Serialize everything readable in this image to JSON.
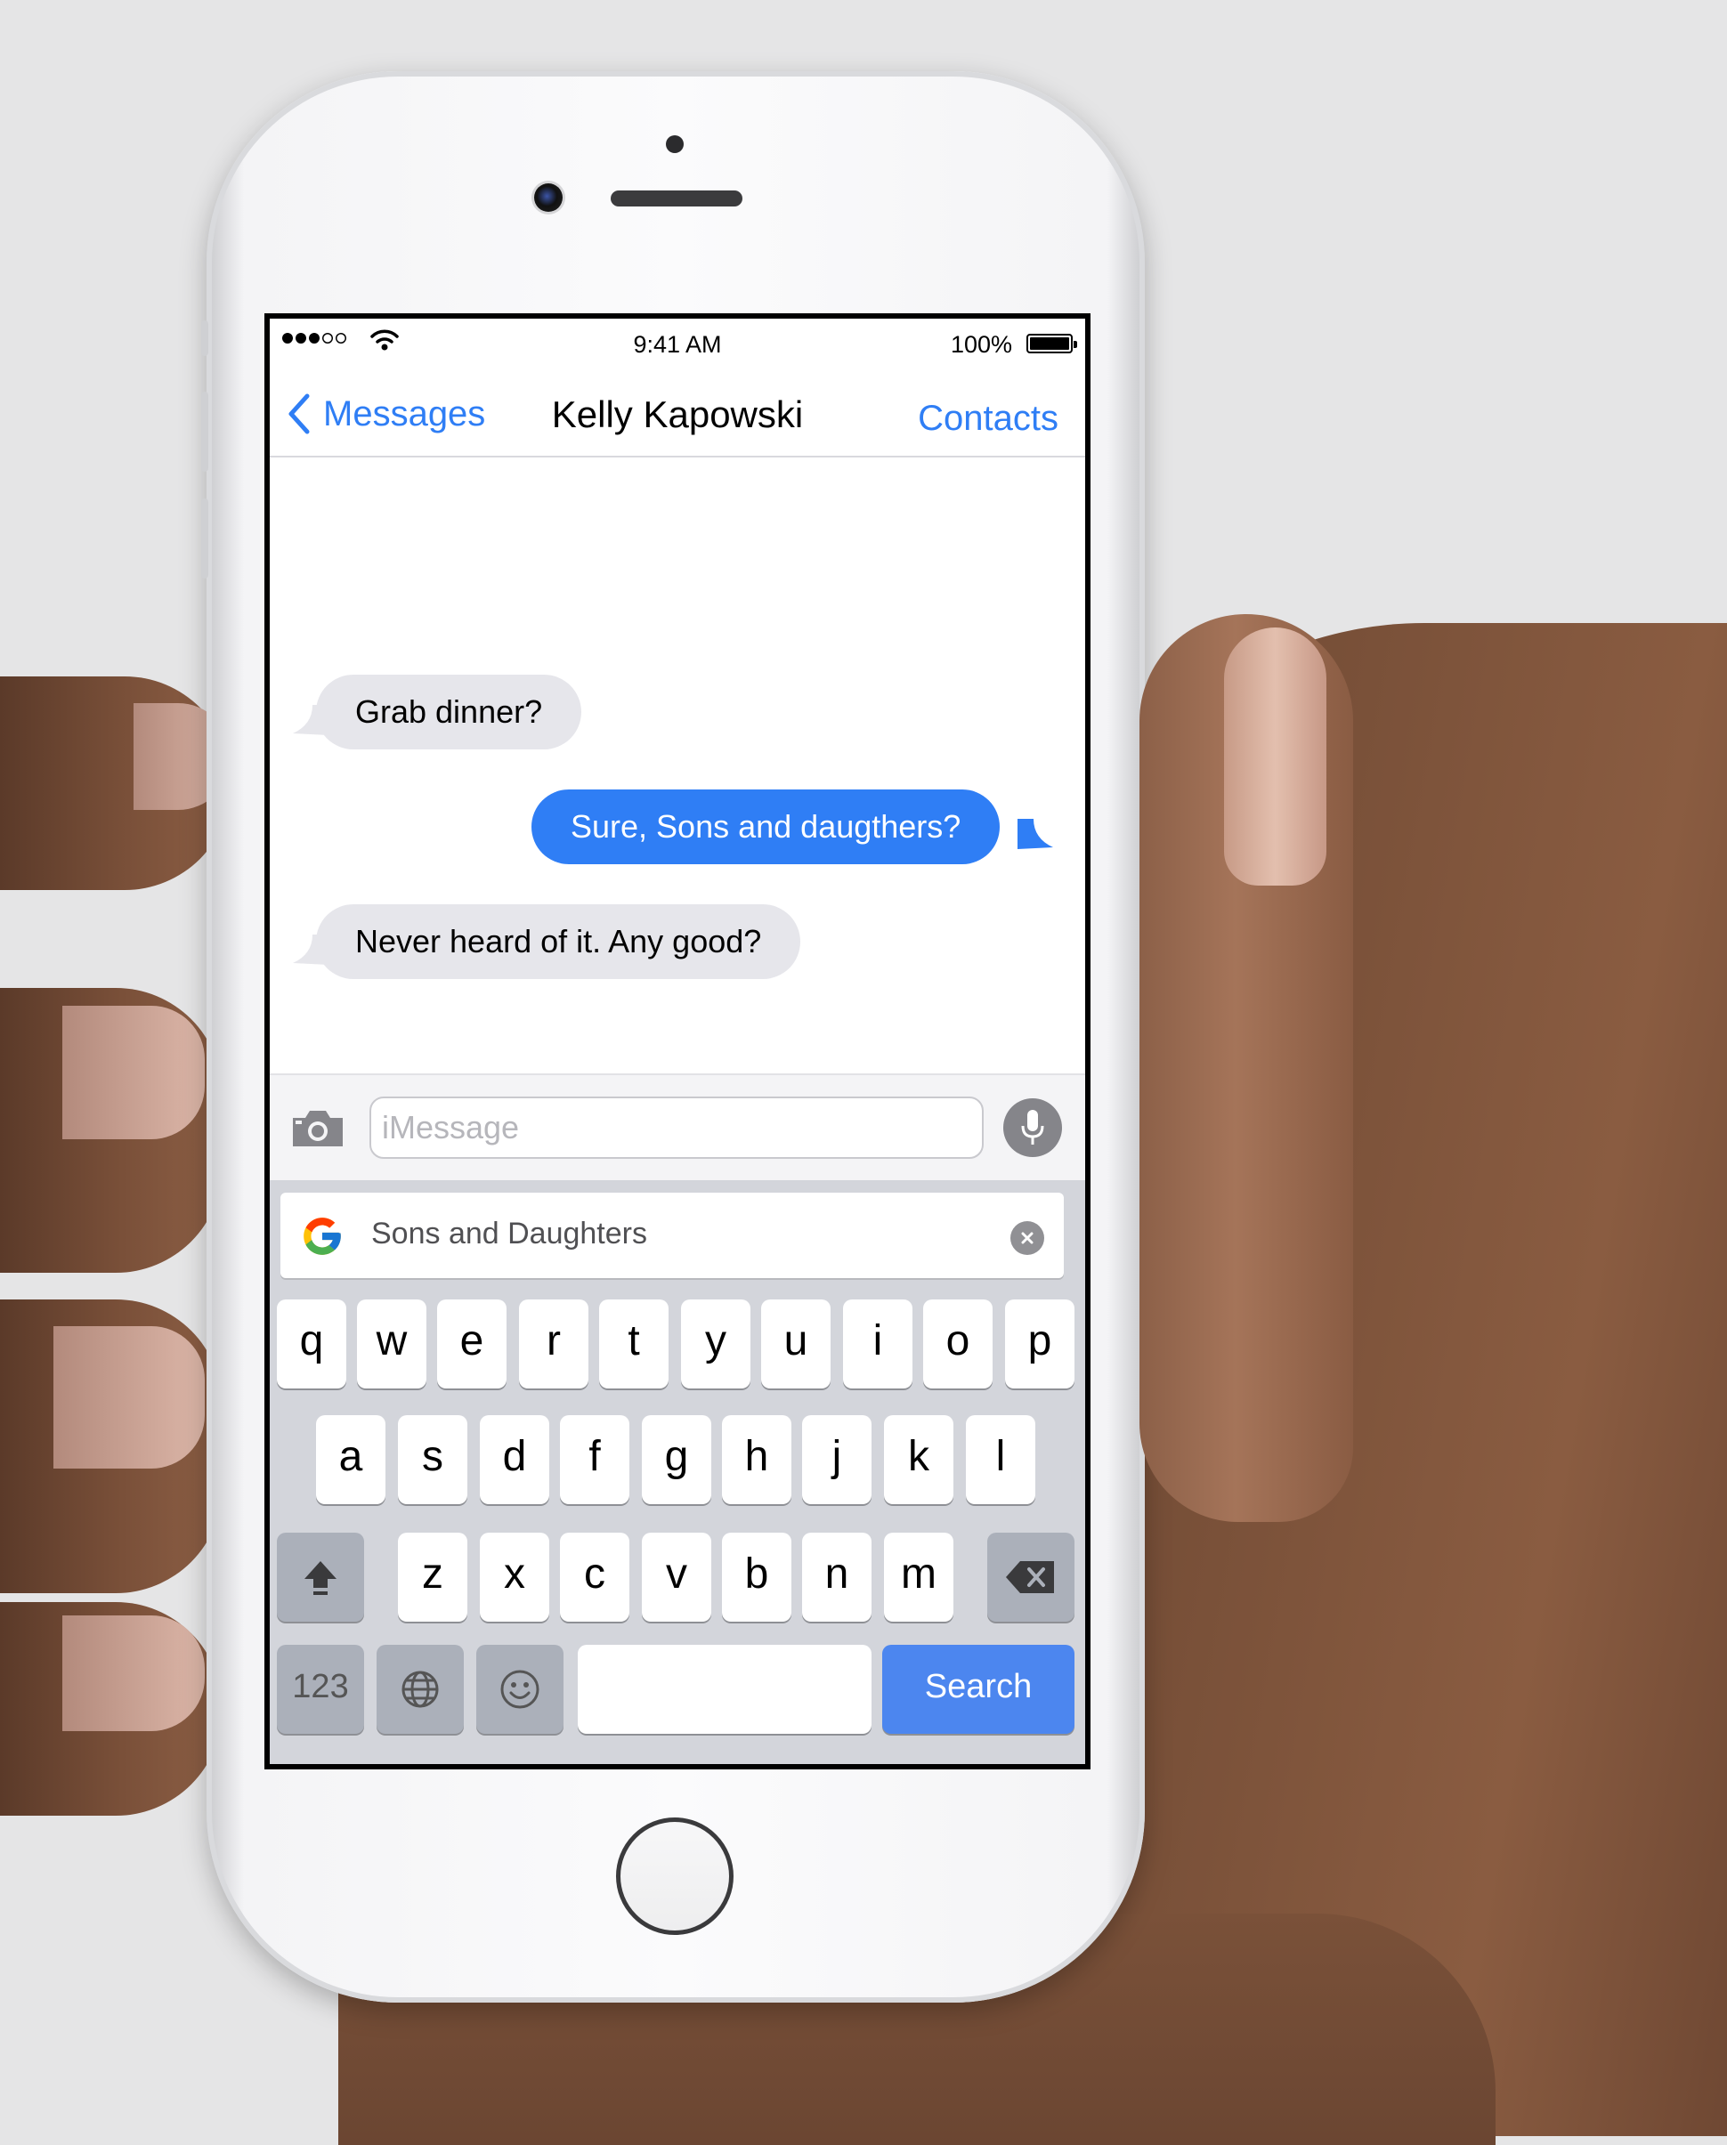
{
  "status_bar": {
    "time": "9:41 AM",
    "battery_percent": "100%",
    "signal_bars_filled": 3,
    "signal_bars_total": 5
  },
  "navbar": {
    "back_label": "Messages",
    "title": "Kelly Kapowski",
    "right_label": "Contacts"
  },
  "messages": [
    {
      "direction": "incoming",
      "text": "Grab dinner?"
    },
    {
      "direction": "outgoing",
      "text": "Sure, Sons and daugthers?"
    },
    {
      "direction": "incoming",
      "text": "Never heard of it. Any good?"
    }
  ],
  "input": {
    "placeholder": "iMessage"
  },
  "keyboard": {
    "search_query": "Sons and Daughters",
    "row1": [
      "q",
      "w",
      "e",
      "r",
      "t",
      "y",
      "u",
      "i",
      "o",
      "p"
    ],
    "row2": [
      "a",
      "s",
      "d",
      "f",
      "g",
      "h",
      "j",
      "k",
      "l"
    ],
    "row3": [
      "z",
      "x",
      "c",
      "v",
      "b",
      "n",
      "m"
    ],
    "numbers_key": "123",
    "action_key": "Search"
  },
  "colors": {
    "accent": "#2f7ef5",
    "incoming_bubble": "#e6e6eb",
    "search_key": "#4c86ef"
  }
}
